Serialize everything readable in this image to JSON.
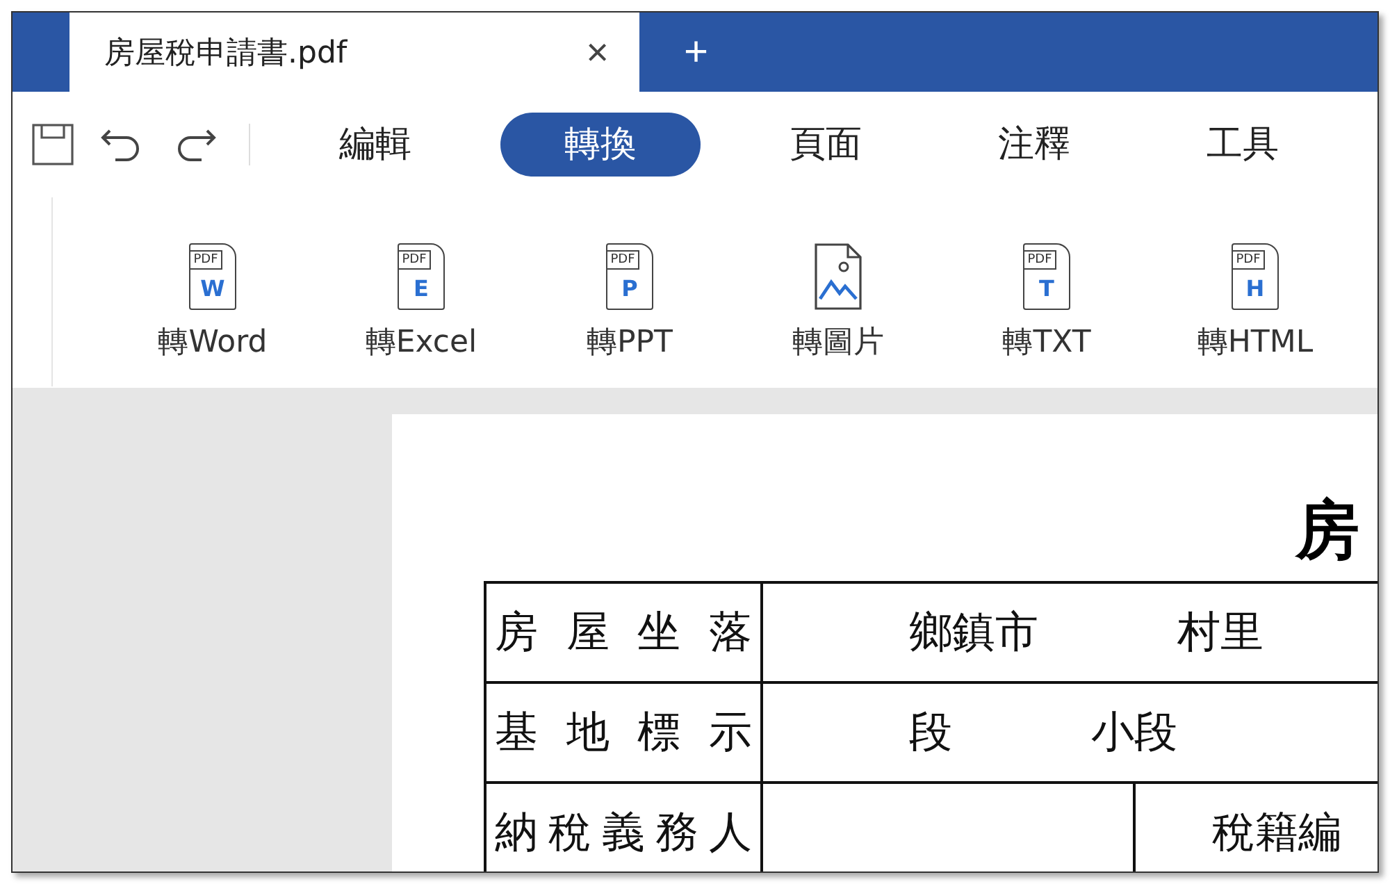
{
  "tabs": [
    {
      "title": "房屋稅申請書.pdf",
      "close": "×",
      "selected": true
    }
  ],
  "new_tab": "+",
  "menu": [
    {
      "label": "編輯",
      "selected": false
    },
    {
      "label": "轉換",
      "selected": true
    },
    {
      "label": "頁面",
      "selected": false
    },
    {
      "label": "注釋",
      "selected": false
    },
    {
      "label": "工具",
      "selected": false
    }
  ],
  "convert_tools": [
    {
      "kind": "doc",
      "tag": "PDF",
      "letter": "W",
      "label": "轉Word"
    },
    {
      "kind": "doc",
      "tag": "PDF",
      "letter": "E",
      "label": "轉Excel"
    },
    {
      "kind": "doc",
      "tag": "PDF",
      "letter": "P",
      "label": "轉PPT"
    },
    {
      "kind": "image",
      "label": "轉圖片"
    },
    {
      "kind": "doc",
      "tag": "PDF",
      "letter": "T",
      "label": "轉TXT"
    },
    {
      "kind": "doc",
      "tag": "PDF",
      "letter": "H",
      "label": "轉HTML"
    }
  ],
  "document": {
    "title": "房",
    "rows": [
      {
        "label": "房屋坐落",
        "cells": [
          {
            "texts": [
              "鄉鎮市",
              "村里"
            ]
          }
        ]
      },
      {
        "label": "基地標示",
        "cells": [
          {
            "texts": [
              "段",
              "小段"
            ]
          }
        ]
      },
      {
        "label": "納稅義務人",
        "cells": [
          {},
          {
            "texts": [
              "稅籍編"
            ]
          }
        ]
      }
    ]
  }
}
